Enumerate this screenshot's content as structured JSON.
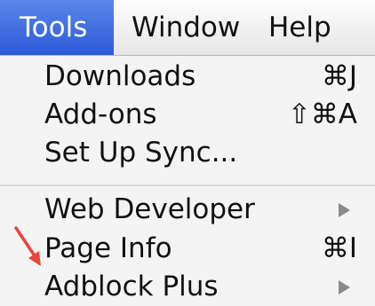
{
  "menubar": {
    "items": [
      {
        "label": "Tools",
        "active": true
      },
      {
        "label": "Window",
        "active": false
      },
      {
        "label": "Help",
        "active": false
      }
    ]
  },
  "menu": {
    "items": [
      {
        "label": "Downloads",
        "shortcut": "⌘J"
      },
      {
        "label": "Add-ons",
        "shortcut": "⇧⌘A"
      },
      {
        "label": "Set Up Sync..."
      },
      {
        "label": "Web Developer",
        "submenu": true
      },
      {
        "label": "Page Info",
        "shortcut": "⌘I"
      },
      {
        "label": "Adblock Plus",
        "submenu": true
      }
    ]
  },
  "annotation": {
    "arrow_color": "#e8453c",
    "points_to": "Adblock Plus"
  },
  "colors": {
    "menubar_highlight": "#2f62e0",
    "menu_background": "#f4f4f4"
  }
}
